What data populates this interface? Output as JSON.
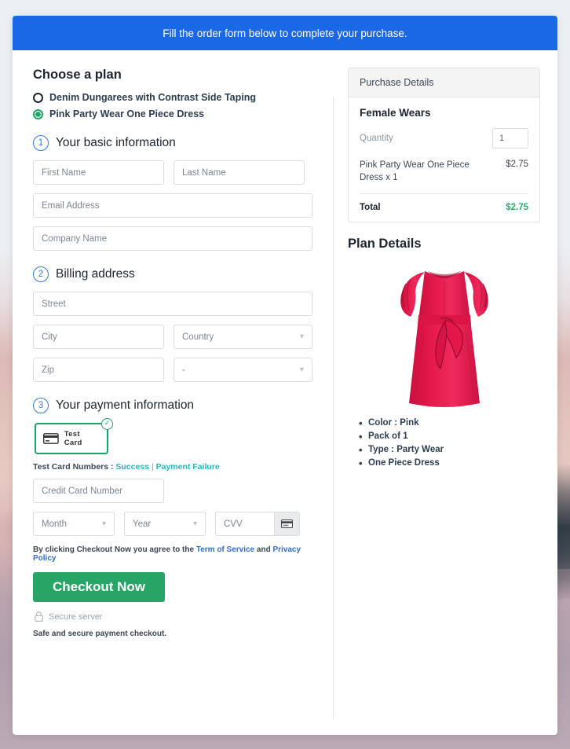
{
  "banner": {
    "text": "Fill the order form below to complete your purchase."
  },
  "plan": {
    "heading": "Choose a plan",
    "options": [
      {
        "label": "Denim Dungarees with Contrast Side Taping",
        "selected": false
      },
      {
        "label": "Pink Party Wear One Piece Dress",
        "selected": true
      }
    ]
  },
  "steps": {
    "basic": {
      "num": "1",
      "label": "Your basic information"
    },
    "billing": {
      "num": "2",
      "label": "Billing address"
    },
    "payment": {
      "num": "3",
      "label": "Your payment information"
    }
  },
  "fields": {
    "first_name": "First Name",
    "last_name": "Last Name",
    "email": "Email Address",
    "company": "Company Name",
    "street": "Street",
    "city": "City",
    "country": "Country",
    "zip": "Zip",
    "state": "-",
    "credit_card": "Credit Card Number",
    "month": "Month",
    "year": "Year",
    "cvv": "CVV"
  },
  "payment": {
    "method_label": "Test Card",
    "test_numbers_prefix": "Test Card Numbers :",
    "success_link": "Success",
    "separator": "|",
    "failure_link": "Payment Failure"
  },
  "footer": {
    "agree_prefix": "By clicking Checkout Now you agree to the",
    "terms_link": "Term of Service",
    "agree_and": "and",
    "privacy_link": "Privacy Policy",
    "checkout_button": "Checkout Now",
    "secure_server": "Secure server",
    "safe_note": "Safe and secure payment checkout."
  },
  "purchase_details": {
    "header": "Purchase Details",
    "category": "Female Wears",
    "quantity_label": "Quantity",
    "quantity_value": "1",
    "item_name": "Pink Party Wear One Piece Dress x 1",
    "item_price": "$2.75",
    "total_label": "Total",
    "total_value": "$2.75"
  },
  "plan_details": {
    "heading": "Plan Details",
    "bullets": [
      "Color : Pink",
      "Pack of 1",
      "Type : Party Wear",
      "One Piece Dress"
    ]
  },
  "colors": {
    "banner_blue": "#1a68e5",
    "accent_green": "#27a567",
    "total_green": "#22b06b",
    "link_blue": "#2f6fd0",
    "link_teal": "#2bb3c0",
    "dress_pink": "#e3174a"
  }
}
